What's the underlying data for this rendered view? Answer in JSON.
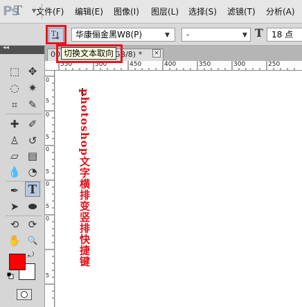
{
  "app": {
    "logo": "Ps"
  },
  "menu": {
    "items": [
      "文件(F)",
      "编辑(E)",
      "图像(I)",
      "图层(L)",
      "选择(S)",
      "滤镜(T)",
      "分析(A)"
    ]
  },
  "options_bar": {
    "tool_preset_glyph": "T",
    "toggle_orientation_icon": "text-orientation-icon",
    "font_family": "华康俪金黑W8(P)",
    "font_style": "-",
    "font_size_icon_glyph": "T",
    "font_size": "18 点"
  },
  "tooltip": {
    "text": "切换文本取向"
  },
  "document": {
    "tab_left": "00",
    "tab_right": "GB/8) *",
    "close_glyph": "×"
  },
  "ruler": {
    "top_labels": [
      "550",
      "500",
      "450",
      "400",
      "350",
      "300",
      "250"
    ],
    "left_labels": [
      "0",
      "5",
      "0",
      "5",
      "0",
      "5",
      "0",
      "5",
      "0",
      "5"
    ]
  },
  "canvas": {
    "vertical_text": "photoshop文字横排变竖排快捷键",
    "text_color": "#e10e16"
  },
  "colors": {
    "foreground": "#ff0000",
    "background": "#ffffff",
    "highlight": "#e8141c"
  },
  "tools": [
    {
      "name": "marquee-icon",
      "glyph": "⬚"
    },
    {
      "name": "move-icon",
      "glyph": "✥"
    },
    {
      "name": "lasso-icon",
      "glyph": "◌"
    },
    {
      "name": "magic-wand-icon",
      "glyph": "✷"
    },
    {
      "name": "crop-icon",
      "glyph": "⌗"
    },
    {
      "name": "eyedropper-icon",
      "glyph": "✎"
    },
    {
      "name": "healing-brush-icon",
      "glyph": "✚"
    },
    {
      "name": "brush-icon",
      "glyph": "✐"
    },
    {
      "name": "clone-stamp-icon",
      "glyph": "♙"
    },
    {
      "name": "history-brush-icon",
      "glyph": "↺"
    },
    {
      "name": "eraser-icon",
      "glyph": "▱"
    },
    {
      "name": "gradient-icon",
      "glyph": "▤"
    },
    {
      "name": "blur-icon",
      "glyph": "💧"
    },
    {
      "name": "dodge-icon",
      "glyph": "◔"
    },
    {
      "name": "pen-icon",
      "glyph": "✒"
    },
    {
      "name": "type-icon",
      "glyph": "T"
    },
    {
      "name": "path-selection-icon",
      "glyph": "➤"
    },
    {
      "name": "shape-icon",
      "glyph": "⬬"
    },
    {
      "name": "3d-rotate-icon",
      "glyph": "⟲"
    },
    {
      "name": "3d-orbit-icon",
      "glyph": "⟳"
    },
    {
      "name": "hand-icon",
      "glyph": "✋"
    },
    {
      "name": "zoom-icon",
      "glyph": "🔍"
    }
  ]
}
